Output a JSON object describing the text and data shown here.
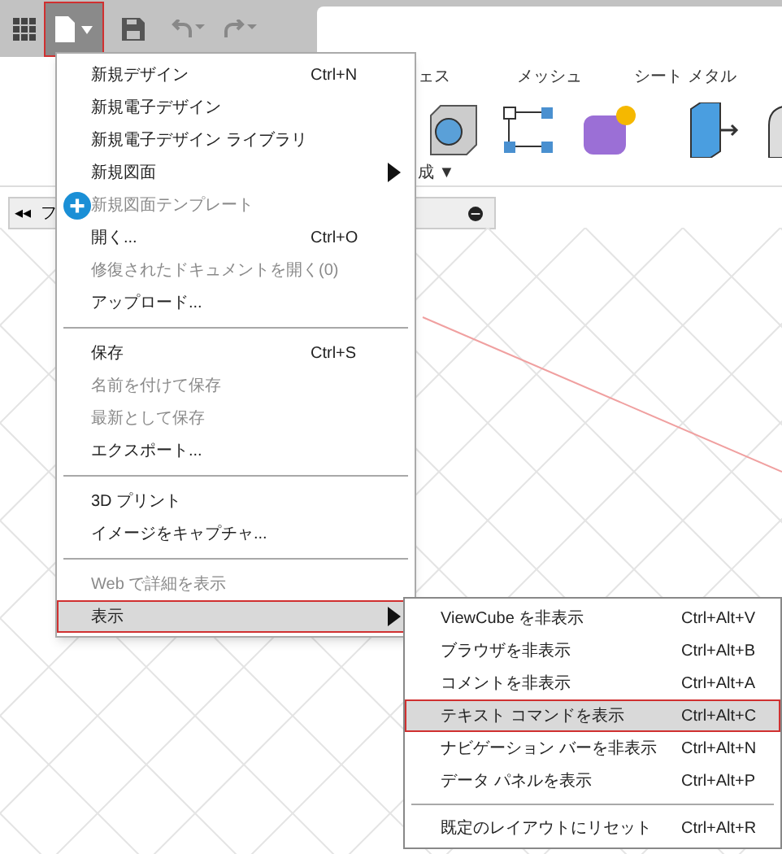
{
  "toolbar": {
    "file_button": {
      "marked": true,
      "expanded": true
    }
  },
  "ribbon": {
    "groups": [
      {
        "label": "ェス"
      },
      {
        "label": "メッシュ"
      },
      {
        "label": "シート メタル"
      }
    ],
    "dropdown_label": "成 ▼"
  },
  "browser": {
    "collapse": "◂◂",
    "label": "フ"
  },
  "file_menu": [
    {
      "kind": "item",
      "label": "新規デザイン",
      "shortcut": "Ctrl+N",
      "disabled": false,
      "submenu": false,
      "selected": false,
      "marked": false
    },
    {
      "kind": "item",
      "label": "新規電子デザイン",
      "disabled": false,
      "submenu": false,
      "selected": false,
      "marked": false
    },
    {
      "kind": "item",
      "label": "新規電子デザイン ライブラリ",
      "disabled": false,
      "submenu": false,
      "selected": false,
      "marked": false
    },
    {
      "kind": "item",
      "label": "新規図面",
      "disabled": false,
      "submenu": true,
      "selected": false,
      "marked": false
    },
    {
      "kind": "icon-item",
      "label": "新規図面テンプレート",
      "disabled": true,
      "submenu": false,
      "selected": false,
      "marked": false
    },
    {
      "kind": "item",
      "label": "開く...",
      "shortcut": "Ctrl+O",
      "disabled": false,
      "submenu": false,
      "selected": false,
      "marked": false
    },
    {
      "kind": "item",
      "label": "修復されたドキュメントを開く(0)",
      "disabled": true,
      "submenu": false,
      "selected": false,
      "marked": false
    },
    {
      "kind": "item",
      "label": "アップロード...",
      "disabled": false,
      "submenu": false,
      "selected": false,
      "marked": false
    },
    {
      "kind": "divider"
    },
    {
      "kind": "item",
      "label": "保存",
      "shortcut": "Ctrl+S",
      "disabled": false,
      "submenu": false,
      "selected": false,
      "marked": false
    },
    {
      "kind": "item",
      "label": "名前を付けて保存",
      "disabled": true,
      "submenu": false,
      "selected": false,
      "marked": false
    },
    {
      "kind": "item",
      "label": "最新として保存",
      "disabled": true,
      "submenu": false,
      "selected": false,
      "marked": false
    },
    {
      "kind": "item",
      "label": "エクスポート...",
      "disabled": false,
      "submenu": false,
      "selected": false,
      "marked": false
    },
    {
      "kind": "divider"
    },
    {
      "kind": "item",
      "label": "3D プリント",
      "disabled": false,
      "submenu": false,
      "selected": false,
      "marked": false
    },
    {
      "kind": "item",
      "label": "イメージをキャプチャ...",
      "disabled": false,
      "submenu": false,
      "selected": false,
      "marked": false
    },
    {
      "kind": "divider"
    },
    {
      "kind": "item",
      "label": "Web で詳細を表示",
      "disabled": true,
      "submenu": false,
      "selected": false,
      "marked": false
    },
    {
      "kind": "item",
      "label": "表示",
      "disabled": false,
      "submenu": true,
      "selected": true,
      "marked": true
    }
  ],
  "view_submenu": [
    {
      "kind": "item",
      "label": "ViewCube を非表示",
      "shortcut": "Ctrl+Alt+V",
      "selected": false,
      "marked": false
    },
    {
      "kind": "item",
      "label": "ブラウザを非表示",
      "shortcut": "Ctrl+Alt+B",
      "selected": false,
      "marked": false
    },
    {
      "kind": "item",
      "label": "コメントを非表示",
      "shortcut": "Ctrl+Alt+A",
      "selected": false,
      "marked": false
    },
    {
      "kind": "item",
      "label": "テキスト コマンドを表示",
      "shortcut": "Ctrl+Alt+C",
      "selected": true,
      "marked": true
    },
    {
      "kind": "item",
      "label": "ナビゲーション バーを非表示",
      "shortcut": "Ctrl+Alt+N",
      "selected": false,
      "marked": false
    },
    {
      "kind": "item",
      "label": "データ パネルを表示",
      "shortcut": "Ctrl+Alt+P",
      "selected": false,
      "marked": false
    },
    {
      "kind": "divider"
    },
    {
      "kind": "item",
      "label": "既定のレイアウトにリセット",
      "shortcut": "Ctrl+Alt+R",
      "selected": false,
      "marked": false
    }
  ]
}
